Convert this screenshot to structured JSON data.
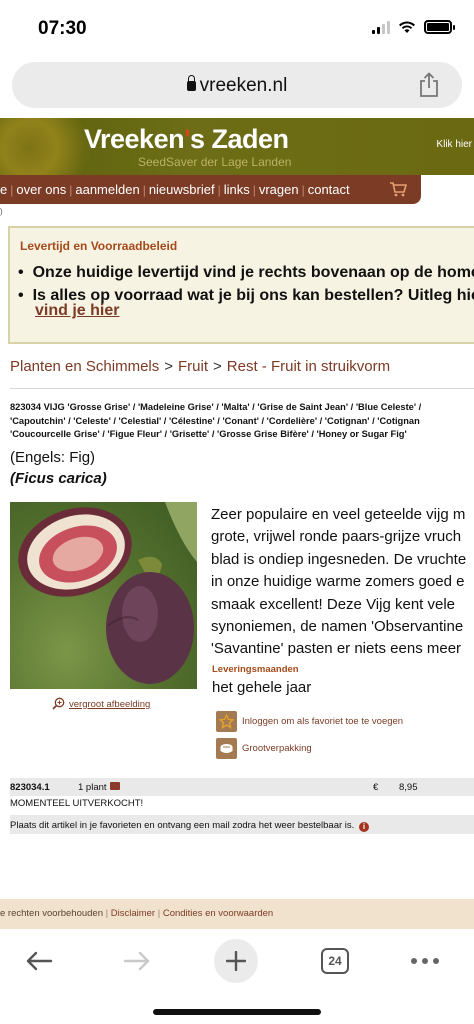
{
  "status": {
    "time": "07:30"
  },
  "browser": {
    "url": "vreeken.nl",
    "tab_count": "24"
  },
  "site": {
    "title_part1": "Vreeken",
    "title_apostrophe": "'",
    "title_part2": "s Zaden",
    "subtitle": "SeedSaver der Lage Landen",
    "klik_hier": "Klik hier"
  },
  "nav": {
    "items": [
      "e",
      "over ons",
      "aanmelden",
      "nieuwsbrief",
      "links",
      "vragen",
      "contact"
    ],
    "separator": "|"
  },
  "tiny_mark": ")",
  "notice": {
    "title": "Levertijd en Voorraadbeleid",
    "line1": "Onze huidige levertijd vind je rechts bovenaan op de home",
    "line2": "Is alles op voorraad wat je bij ons kan bestellen? Uitleg hie",
    "link": "vind je hier"
  },
  "breadcrumb": {
    "items": [
      "Planten en Schimmels",
      "Fruit",
      "Rest - Fruit in struikvorm"
    ],
    "separator": ">"
  },
  "product": {
    "heading_lines": [
      "823034 VIJG 'Grosse Grise' / 'Madeleine Grise' / 'Malta' / 'Grise de Saint Jean' / 'Blue Celeste' /",
      "'Capoutchin' / 'Celeste' / 'Celestial' / 'Célestine' / 'Conant' / 'Cordelière' / 'Cotignan' / 'Cotignan",
      "'Coucourcelle Grise' / 'Figue Fleur' / 'Grisette' / 'Grosse Grise Bifère' / 'Honey or Sugar Fig'"
    ],
    "english": "(Engels: Fig)",
    "latin": "(Ficus carica)",
    "zoom_label": "vergroot afbeelding",
    "description_lines": [
      "Zeer populaire en veel geteelde vijg m",
      "grote, vrijwel ronde paars-grijze vruch",
      "blad is ondiep ingesneden. De vruchte",
      "in onze huidige warme zomers goed e",
      "smaak excellent! Deze Vijg kent vele",
      "synoniemen, de namen 'Observantine",
      "'Savantine' pasten er niets eens meer"
    ],
    "months_label": "Leveringsmaanden",
    "months_value": "het gehele jaar",
    "fav_label": "Inloggen om als favoriet toe te voegen",
    "bulk_label": "Grootverpakking"
  },
  "order": {
    "code": "823034.1",
    "qty": "1 plant",
    "currency": "€",
    "price": "8,95",
    "sold_out": "MOMENTEEL UITVERKOCHT!",
    "notify": "Plaats dit artikel in je favorieten en ontvang een mail zodra het weer bestelbaar is."
  },
  "footer": {
    "rights": "e rechten voorbehouden",
    "separator": "|",
    "disclaimer": "Disclaimer",
    "terms": "Condities en voorwaarden"
  },
  "icons": [
    "lock-icon",
    "share-icon",
    "cart-icon",
    "zoom-icon",
    "star-icon",
    "bulk-icon",
    "info-icon",
    "back-icon",
    "forward-icon",
    "plus-icon",
    "tabs-icon",
    "more-icon"
  ],
  "colors": {
    "brand_brown": "#7b3b25",
    "header_olive": "#6c6d16",
    "accent_orange": "#d5481b",
    "notice_bg": "#f6f3e3",
    "footer_bg": "#f1e2cd"
  }
}
